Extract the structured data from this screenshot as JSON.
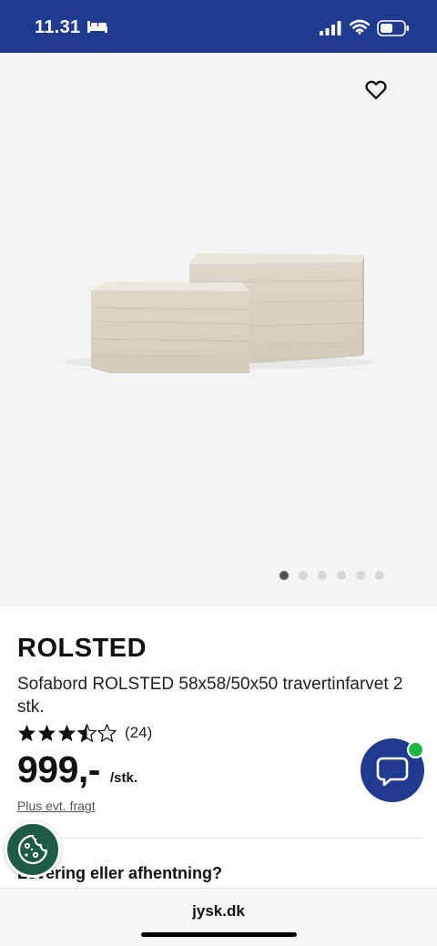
{
  "status_bar": {
    "time": "11.31",
    "icons": [
      "bed-icon",
      "signal-icon",
      "wifi-icon",
      "battery-icon"
    ]
  },
  "gallery": {
    "image_count": 6,
    "active_index": 0,
    "favorite_icon": "heart-outline-icon",
    "background": "#f4f4f4"
  },
  "product": {
    "brand": "ROLSTED",
    "description": "Sofabord ROLSTED 58x58/50x50 travertinfarvet 2 stk.",
    "rating": 3.5,
    "rating_max": 5,
    "review_count": "(24)",
    "price": "999,-",
    "unit": "/stk.",
    "shipping_note": "Plus evt. fragt"
  },
  "delivery": {
    "heading": "Levering eller afhentning?"
  },
  "floating": {
    "chat_icon": "chat-bubble-icon",
    "cookie_icon": "cookie-icon",
    "online_color": "#1fb542"
  },
  "browser": {
    "url": "jysk.dk"
  },
  "colors": {
    "brand_blue": "#1f3a8f",
    "cookie_green": "#1f5c47"
  }
}
